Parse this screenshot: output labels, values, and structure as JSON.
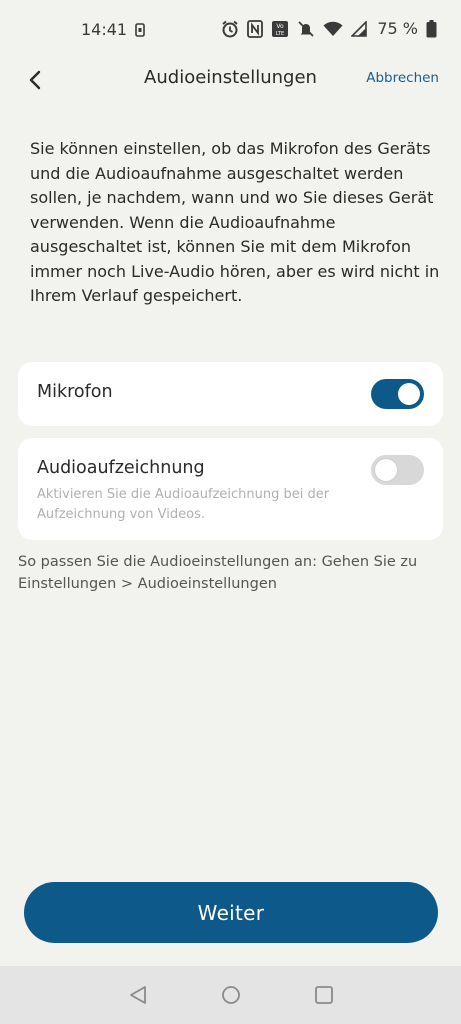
{
  "status_bar": {
    "time": "14:41",
    "battery": "75 %",
    "icons": [
      "sim-icon",
      "alarm-icon",
      "nfc-icon",
      "volte-icon",
      "mute-icon",
      "wifi-icon",
      "signal-icon",
      "battery-icon"
    ]
  },
  "header": {
    "title": "Audioeinstellungen",
    "cancel_label": "Abbrechen",
    "back_icon": "chevron-left-icon"
  },
  "intro_text": "Sie können einstellen, ob das Mikrofon des Geräts und die Audioaufnahme ausgeschaltet werden sollen, je nachdem, wann und wo Sie dieses Gerät verwenden. Wenn die Audioaufnahme ausgeschaltet ist, können Sie mit dem Mikrofon immer noch Live-Audio hören, aber es wird nicht in Ihrem Verlauf gespeichert.",
  "settings": {
    "microphone": {
      "label": "Mikrofon",
      "enabled": true
    },
    "audio_recording": {
      "label": "Audioaufzeichnung",
      "description": "Aktivieren Sie die Audioaufzeichnung bei der Aufzeichnung von Videos.",
      "enabled": false
    }
  },
  "hint_text": "So passen Sie die Audioeinstellungen an: Gehen Sie zu Einstellungen > Audioeinstellungen",
  "primary_button": {
    "label": "Weiter"
  },
  "colors": {
    "accent": "#0d5a8a",
    "link": "#1b5f8c",
    "background": "#f2f2ef",
    "card": "#ffffff",
    "toggle_off": "#d8d8d8"
  },
  "nav_bar": {
    "icons": [
      "nav-back-icon",
      "nav-home-icon",
      "nav-recents-icon"
    ]
  }
}
